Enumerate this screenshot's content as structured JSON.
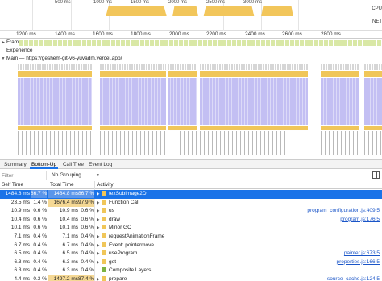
{
  "overview": {
    "ticks": [
      "500 ms",
      "1000 ms",
      "1500 ms",
      "2000 ms",
      "2500 ms",
      "3000 ms"
    ],
    "side_labels": [
      "CPU",
      "NET"
    ]
  },
  "ruler": {
    "ticks": [
      "1200 ms",
      "1400 ms",
      "1600 ms",
      "1800 ms",
      "2000 ms",
      "2200 ms",
      "2400 ms",
      "2600 ms",
      "2800 ms"
    ]
  },
  "tracks": {
    "frames_label": "Frames",
    "experience_label": "Experience",
    "main_label": "Main — https://geshem-git-v6-yuvadm.vercel.app/"
  },
  "tabs": [
    "Summary",
    "Bottom-Up",
    "Call Tree",
    "Event Log"
  ],
  "active_tab": "Bottom-Up",
  "filter": {
    "placeholder": "Filter",
    "grouping": "No Grouping"
  },
  "table": {
    "headers": {
      "self": "Self Time",
      "total": "Total Time",
      "activity": "Activity"
    },
    "rows": [
      {
        "self_ms": "1484.8 ms",
        "self_pct": "86.7 %",
        "total_ms": "1484.8 ms",
        "total_pct": "86.7 %",
        "activity": "texSubImage2D",
        "swatch": "#f0c659",
        "expandable": true,
        "source": "",
        "selected": true
      },
      {
        "self_ms": "23.5 ms",
        "self_pct": "1.4 %",
        "total_ms": "1676.4 ms",
        "total_pct": "97.9 %",
        "activity": "Function Call",
        "swatch": "#f0c659",
        "expandable": true,
        "source": "",
        "selected": false
      },
      {
        "self_ms": "10.9 ms",
        "self_pct": "0.6 %",
        "total_ms": "10.9 ms",
        "total_pct": "0.6 %",
        "activity": "us",
        "swatch": "#f0c659",
        "expandable": true,
        "source": "program_configuration.js:409:5",
        "selected": false
      },
      {
        "self_ms": "10.4 ms",
        "self_pct": "0.6 %",
        "total_ms": "10.4 ms",
        "total_pct": "0.6 %",
        "activity": "draw",
        "swatch": "#f0c659",
        "expandable": true,
        "source": "program.js:176:5",
        "selected": false
      },
      {
        "self_ms": "10.1 ms",
        "self_pct": "0.6 %",
        "total_ms": "10.1 ms",
        "total_pct": "0.6 %",
        "activity": "Minor GC",
        "swatch": "#f0c659",
        "expandable": true,
        "source": "",
        "selected": false
      },
      {
        "self_ms": "7.1 ms",
        "self_pct": "0.4 %",
        "total_ms": "7.1 ms",
        "total_pct": "0.4 %",
        "activity": "requestAnimationFrame",
        "swatch": "#f0c659",
        "expandable": true,
        "source": "",
        "selected": false
      },
      {
        "self_ms": "6.7 ms",
        "self_pct": "0.4 %",
        "total_ms": "6.7 ms",
        "total_pct": "0.4 %",
        "activity": "Event: pointermove",
        "swatch": "#f0c659",
        "expandable": true,
        "source": "",
        "selected": false
      },
      {
        "self_ms": "6.5 ms",
        "self_pct": "0.4 %",
        "total_ms": "6.5 ms",
        "total_pct": "0.4 %",
        "activity": "useProgram",
        "swatch": "#f0c659",
        "expandable": true,
        "source": "painter.js:673:5",
        "selected": false
      },
      {
        "self_ms": "6.3 ms",
        "self_pct": "0.4 %",
        "total_ms": "6.3 ms",
        "total_pct": "0.4 %",
        "activity": "get",
        "swatch": "#f0c659",
        "expandable": true,
        "source": "properties.js:166:5",
        "selected": false
      },
      {
        "self_ms": "6.3 ms",
        "self_pct": "0.4 %",
        "total_ms": "6.3 ms",
        "total_pct": "0.4 %",
        "activity": "Composite Layers",
        "swatch": "#7cb342",
        "expandable": false,
        "source": "",
        "selected": false
      },
      {
        "self_ms": "4.4 ms",
        "self_pct": "0.3 %",
        "total_ms": "1497.2 ms",
        "total_pct": "87.4 %",
        "activity": "prepare",
        "swatch": "#f0c659",
        "expandable": true,
        "source": "source_cache.js:124:5",
        "selected": false
      }
    ]
  },
  "colors": {
    "scripting": "#f0c659",
    "rendering": "#c3bff3",
    "selection": "#1a73e8",
    "painting": "#7cb342"
  }
}
